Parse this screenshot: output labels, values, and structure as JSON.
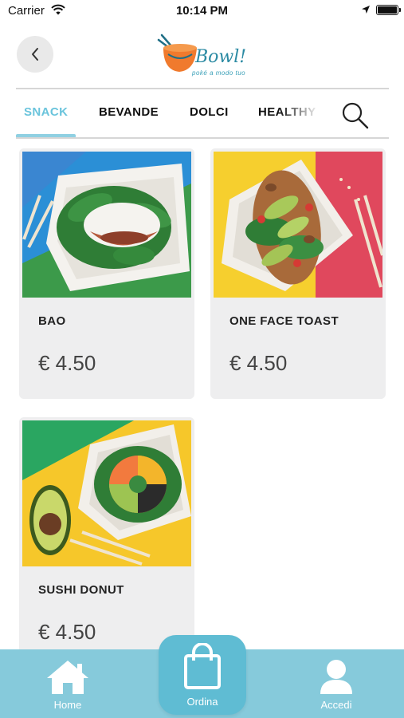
{
  "status_bar": {
    "carrier": "Carrier",
    "time": "10:14 PM"
  },
  "header": {
    "logo_text": "Bowl!",
    "logo_tagline": "poké a modo tuo"
  },
  "tabs": [
    {
      "label": "SNACK",
      "active": true
    },
    {
      "label": "BEVANDE",
      "active": false
    },
    {
      "label": "DOLCI",
      "active": false
    },
    {
      "label": "HEALTHY",
      "active": false
    }
  ],
  "products": [
    {
      "name": "BAO",
      "price": "€ 4.50",
      "image": "bao-photo"
    },
    {
      "name": "ONE FACE TOAST",
      "price": "€ 4.50",
      "image": "avocado-toast-photo"
    },
    {
      "name": "SUSHI DONUT",
      "price": "€ 4.50",
      "image": "sushi-donut-photo"
    }
  ],
  "bottom_nav": {
    "home_label": "Home",
    "order_label": "Ordina",
    "login_label": "Accedi"
  },
  "colors": {
    "accent": "#6ac4dc",
    "bottom_bar": "#86cadb",
    "order_button": "#5fbcd3",
    "card_background": "#eeeeef"
  }
}
